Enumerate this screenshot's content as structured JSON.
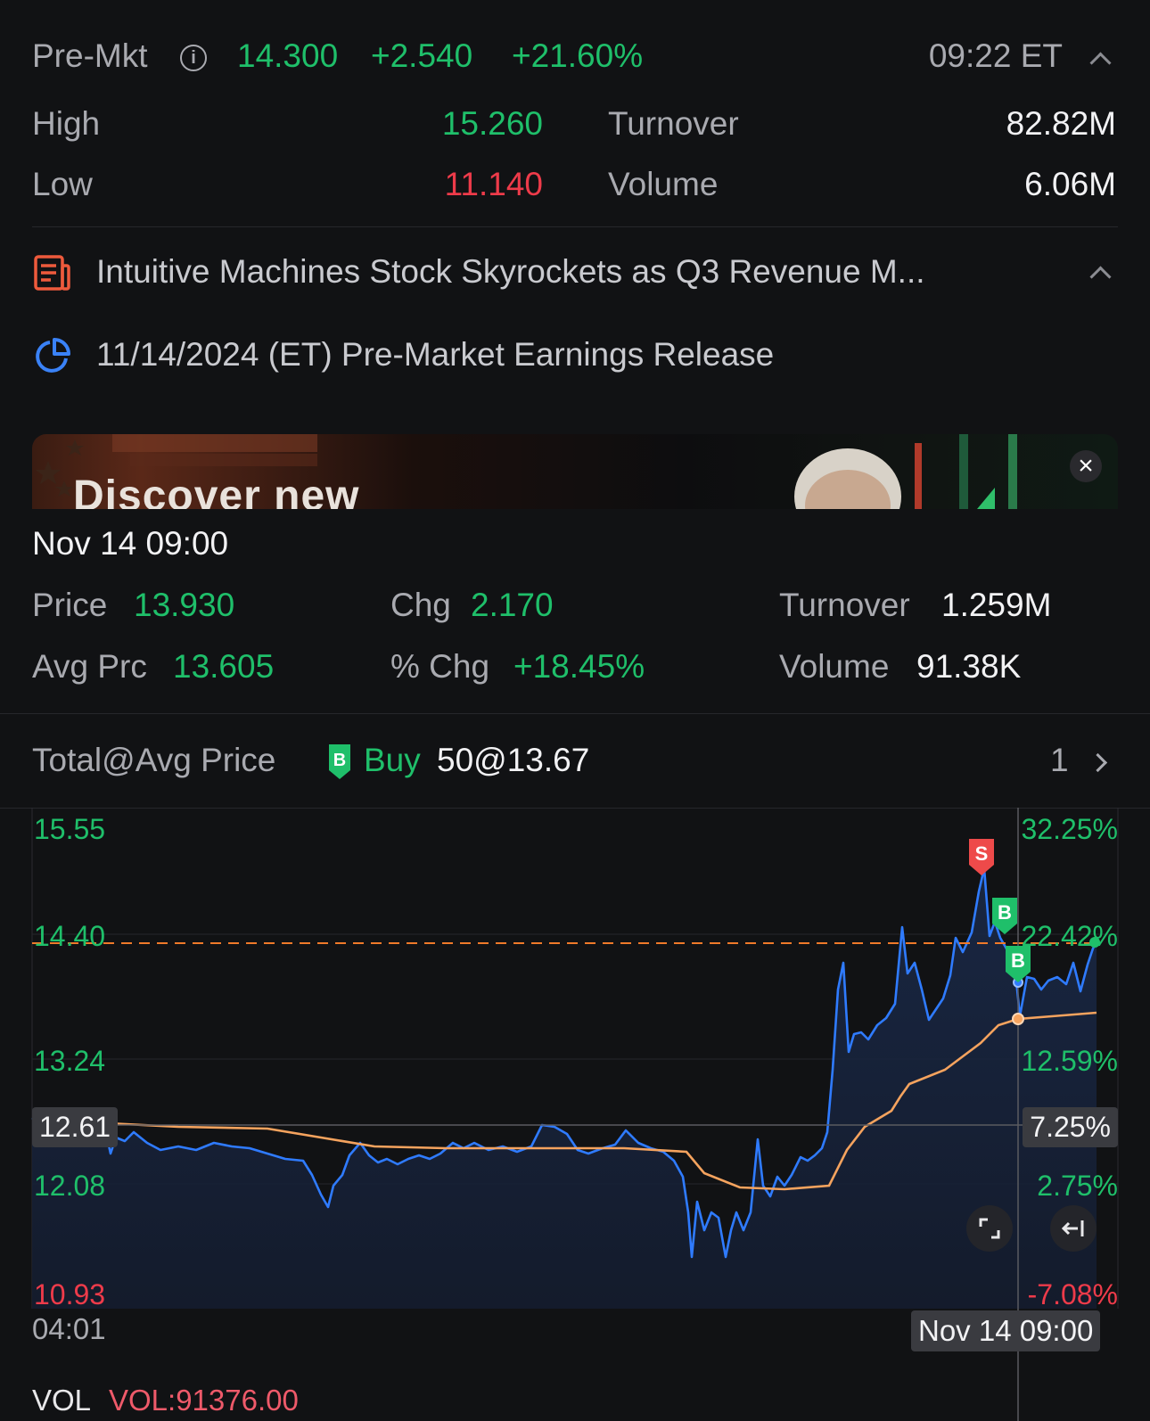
{
  "quote": {
    "session_label": "Pre-Mkt",
    "price": "14.300",
    "change": "+2.540",
    "change_pct": "+21.60%",
    "time": "09:22 ET",
    "high_label": "High",
    "high": "15.260",
    "low_label": "Low",
    "low": "11.140",
    "turnover_label": "Turnover",
    "turnover": "82.82M",
    "volume_label": "Volume",
    "volume": "6.06M"
  },
  "news": {
    "headline": "Intuitive Machines Stock Skyrockets as Q3 Revenue M...",
    "earnings_text": "11/14/2024 (ET)  Pre-Market Earnings Release"
  },
  "banner": {
    "text": "Discover new"
  },
  "detail": {
    "timestamp": "Nov 14 09:00",
    "price_label": "Price",
    "price": "13.930",
    "chg_label": "Chg",
    "chg": "2.170",
    "turnover_label": "Turnover",
    "turnover": "1.259M",
    "avg_label": "Avg Prc",
    "avg": "13.605",
    "pct_label": "% Chg",
    "pct": "+18.45%",
    "volume_label": "Volume",
    "volume": "91.38K"
  },
  "position": {
    "label": "Total@Avg Price",
    "side_badge": "B",
    "side": "Buy",
    "value": "50@13.67",
    "count": "1"
  },
  "chart": {
    "y_left": [
      "15.55",
      "14.40",
      "13.24",
      "12.08",
      "10.93"
    ],
    "y_right": [
      "32.25%",
      "22.42%",
      "12.59%",
      "2.75%",
      "-7.08%"
    ],
    "crosshair_price": "12.61",
    "crosshair_pct": "7.25%",
    "x_start": "04:01",
    "x_cursor": "Nov 14 09:00",
    "sell_marker": "S",
    "buy_marker": "B",
    "colors": {
      "price_line": "#2f7bff",
      "avg_line": "#f5a35e",
      "prev_close": "#f07a2a",
      "up": "#1fbf6a",
      "down": "#ee3b4a"
    }
  },
  "vol": {
    "label": "VOL",
    "value": "VOL:91376.00"
  }
}
